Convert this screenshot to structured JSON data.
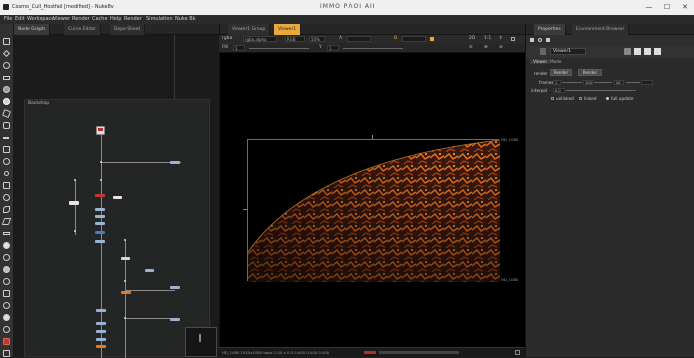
{
  "window": {
    "title": "Cosmo_Cull_Hostfail [modified] - Nuke8v",
    "center_title": "ΙΜΜΟ ΡΛΟΙ ΑΙΙ",
    "controls": [
      "—",
      "☐",
      "✕"
    ]
  },
  "menu": [
    "File",
    "Edit",
    "Workspace",
    "Viewer",
    "Render",
    "Cache",
    "Help",
    "Render",
    "Simulation",
    "Nuke Bk"
  ],
  "left_panel": {
    "tabs": [
      "Node Graph",
      "Curve Editor",
      "Dope Sheet"
    ],
    "backdrop_label": "Backdrop"
  },
  "viewer": {
    "tabs": [
      "Viewer1 Group",
      "Viewer1"
    ],
    "toolbar1": {
      "channels": "rgba",
      "layer": "rgba.alpha",
      "display": "RGB",
      "zoom": "50%",
      "frame_a": "A",
      "frame_b": "B",
      "right_items": [
        "2D",
        "1:1",
        "↕"
      ]
    },
    "toolbar2": {
      "f_label": "f/8",
      "f_value": "1",
      "y_label": "Y",
      "y_value": "1",
      "right_items": [
        "≡",
        "⊕",
        "⊘"
      ]
    },
    "format_top": "HD_1080",
    "format_bottom": "HD_1080",
    "status": "HD_1080 1920x1080 bbox 1.00 x 0 0  0.000 0.000 0.000"
  },
  "properties": {
    "tabs": [
      "Properties",
      "Environment Browser"
    ],
    "node_name": "Viewer1",
    "subtabs": [
      "Viewer",
      "Mode"
    ],
    "row1_label": "render",
    "row1_btn1": "Render",
    "row1_btn2": "Render",
    "row2_label": "frames",
    "row2_from": "1",
    "row2_to": "100",
    "row2_extra": "All",
    "row3_label": "interpol",
    "row3_value": "0.0",
    "check_items": [
      "unlinked",
      "linked",
      "full update"
    ]
  },
  "colors": {
    "accent": "#e8aa3c",
    "panel": "#2b2b2b",
    "node_blue": "#9ab3d5",
    "node_red": "#c0392b",
    "node_orange": "#e07b2a",
    "lava_hot": "#ff7a1a",
    "lava_dark": "#2a1410"
  }
}
